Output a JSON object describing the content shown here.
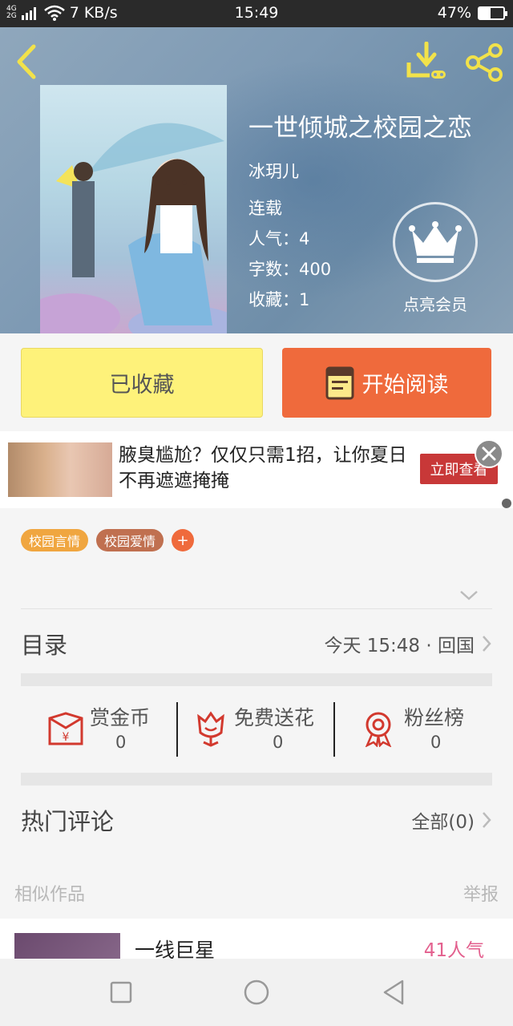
{
  "status_bar": {
    "network": "4G",
    "network2": "2G",
    "speed": "7 KB/s",
    "time": "15:49",
    "battery_text": "47%",
    "battery_level": 0.47
  },
  "book": {
    "title": "一世倾城之校园之恋",
    "author": "冰玥儿",
    "status": "连载",
    "popularity": "人气：4",
    "words": "字数：400",
    "favorites": "收藏：1",
    "vip_label": "点亮会员"
  },
  "actions": {
    "favorited_label": "已收藏",
    "read_label": "开始阅读"
  },
  "ad": {
    "text": "腋臭尴尬？仅仅只需1招，让你夏日不再遮遮掩掩",
    "cta": "立即查看"
  },
  "tags": [
    {
      "label": "校园言情",
      "color": "#f0a640"
    },
    {
      "label": "校园爱情",
      "color": "#c07050"
    }
  ],
  "tag_add": "+",
  "catalog": {
    "title": "目录",
    "latest": "今天 15:48 · 回国"
  },
  "support": [
    {
      "label": "赏金币",
      "value": "0",
      "icon": "red-envelope-icon"
    },
    {
      "label": "免费送花",
      "value": "0",
      "icon": "flower-icon"
    },
    {
      "label": "粉丝榜",
      "value": "0",
      "icon": "medal-icon"
    }
  ],
  "comments": {
    "title": "热门评论",
    "all": "全部(0)"
  },
  "similar": {
    "label": "相似作品",
    "report": "举报",
    "items": [
      {
        "title": "一线巨星",
        "popularity": "41人气"
      }
    ]
  },
  "colors": {
    "accent_orange": "#ef6a3c",
    "favorite_yellow": "#fef27a",
    "icon_red": "#d2392e",
    "popularity_pink": "#e3608e"
  }
}
